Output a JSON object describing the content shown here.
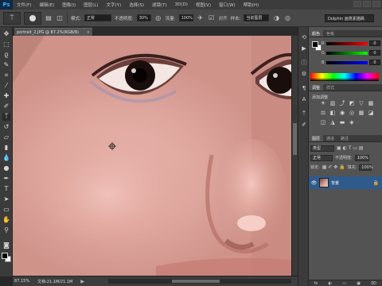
{
  "app": {
    "logo": "Ps"
  },
  "menu": [
    "文件(F)",
    "编辑(E)",
    "图像(I)",
    "图层(L)",
    "文字(Y)",
    "选择(S)",
    "滤镜(T)",
    "3D(D)",
    "视图(V)",
    "窗口(W)",
    "帮助(H)"
  ],
  "options": {
    "mode_label": "模式:",
    "mode_value": "正常",
    "opacity_label": "不透明度:",
    "opacity_value": "30%",
    "flow_label": "流量:",
    "flow_value": "100%",
    "align_label": "对齐",
    "sample_label": "样本:",
    "sample_value": "当前图层",
    "workspace": "Dolphin 画意素描稿"
  },
  "document": {
    "tab_title": "portrait_2.JPG @ 87.2%(RGB/8)",
    "close_glyph": "×"
  },
  "status": {
    "zoom": "87.15%",
    "doc": "文档:21.1M/21.1M",
    "arrow": "▶"
  },
  "panels": {
    "color_tabs": [
      "颜色",
      "色板"
    ],
    "channel_labels": [
      "R",
      "G",
      "B"
    ],
    "channel_values": [
      "0",
      "0",
      "0"
    ],
    "adjust_tabs": [
      "调整",
      "样式"
    ],
    "adjust_title": "添加调整",
    "layer_tabs": [
      "图层",
      "通道",
      "路径"
    ],
    "layer_kind": "类型",
    "blend_mode": "正常",
    "opacity_label": "不透明度:",
    "opacity_value": "100%",
    "lock_label": "锁定:",
    "fill_label": "填充:",
    "fill_value": "100%",
    "layer_name": "背景",
    "footer_icons": [
      "fx",
      "◐",
      "▭",
      "▣",
      "⌦"
    ]
  },
  "colors": {
    "fg": "#000000",
    "bg": "#ffffff",
    "layer_selected": "#2f5a8c"
  }
}
